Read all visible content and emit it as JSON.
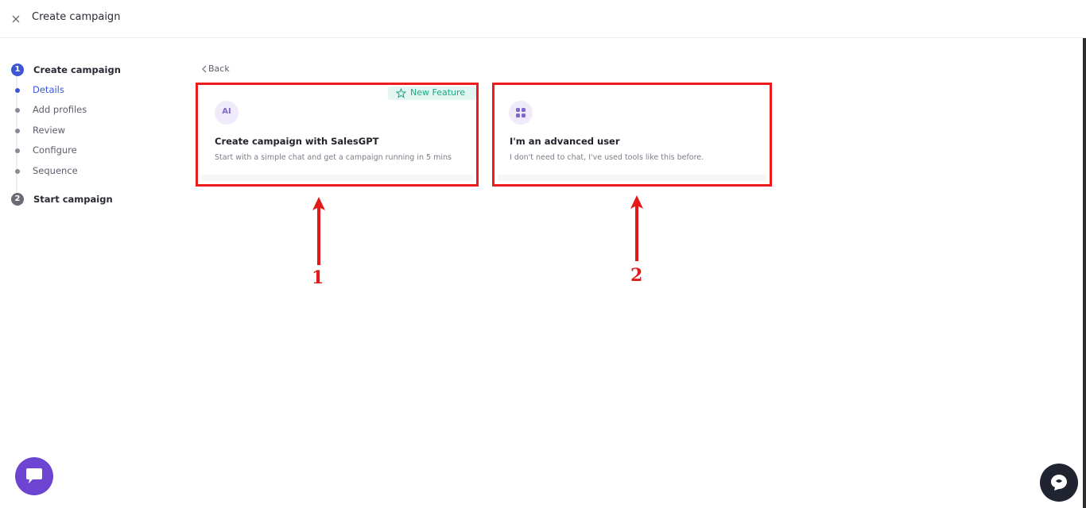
{
  "header": {
    "title": "Create campaign"
  },
  "stepper": {
    "step1": {
      "number": "1",
      "title": "Create campaign"
    },
    "substeps": [
      {
        "label": "Details",
        "active": true
      },
      {
        "label": "Add profiles",
        "active": false
      },
      {
        "label": "Review",
        "active": false
      },
      {
        "label": "Configure",
        "active": false
      },
      {
        "label": "Sequence",
        "active": false
      }
    ],
    "step2": {
      "number": "2",
      "title": "Start campaign"
    }
  },
  "back": {
    "label": "Back"
  },
  "cards": [
    {
      "icon": "ai-badge-icon",
      "icon_text": "AI",
      "badge": "New Feature",
      "title": "Create campaign with SalesGPT",
      "description": "Start with a simple chat and get a campaign running in 5 mins"
    },
    {
      "icon": "grid-icon",
      "title": "I'm an advanced user",
      "description": "I don't need to chat, I've used tools like this before."
    }
  ],
  "annotations": {
    "arrow1_label": "1",
    "arrow2_label": "2"
  },
  "colors": {
    "accent_blue": "#3c56d6",
    "annotation_red": "#ee1c1c",
    "badge_green": "#1aa882",
    "chat_purple": "#6e45d2",
    "help_dark": "#1f2430"
  }
}
